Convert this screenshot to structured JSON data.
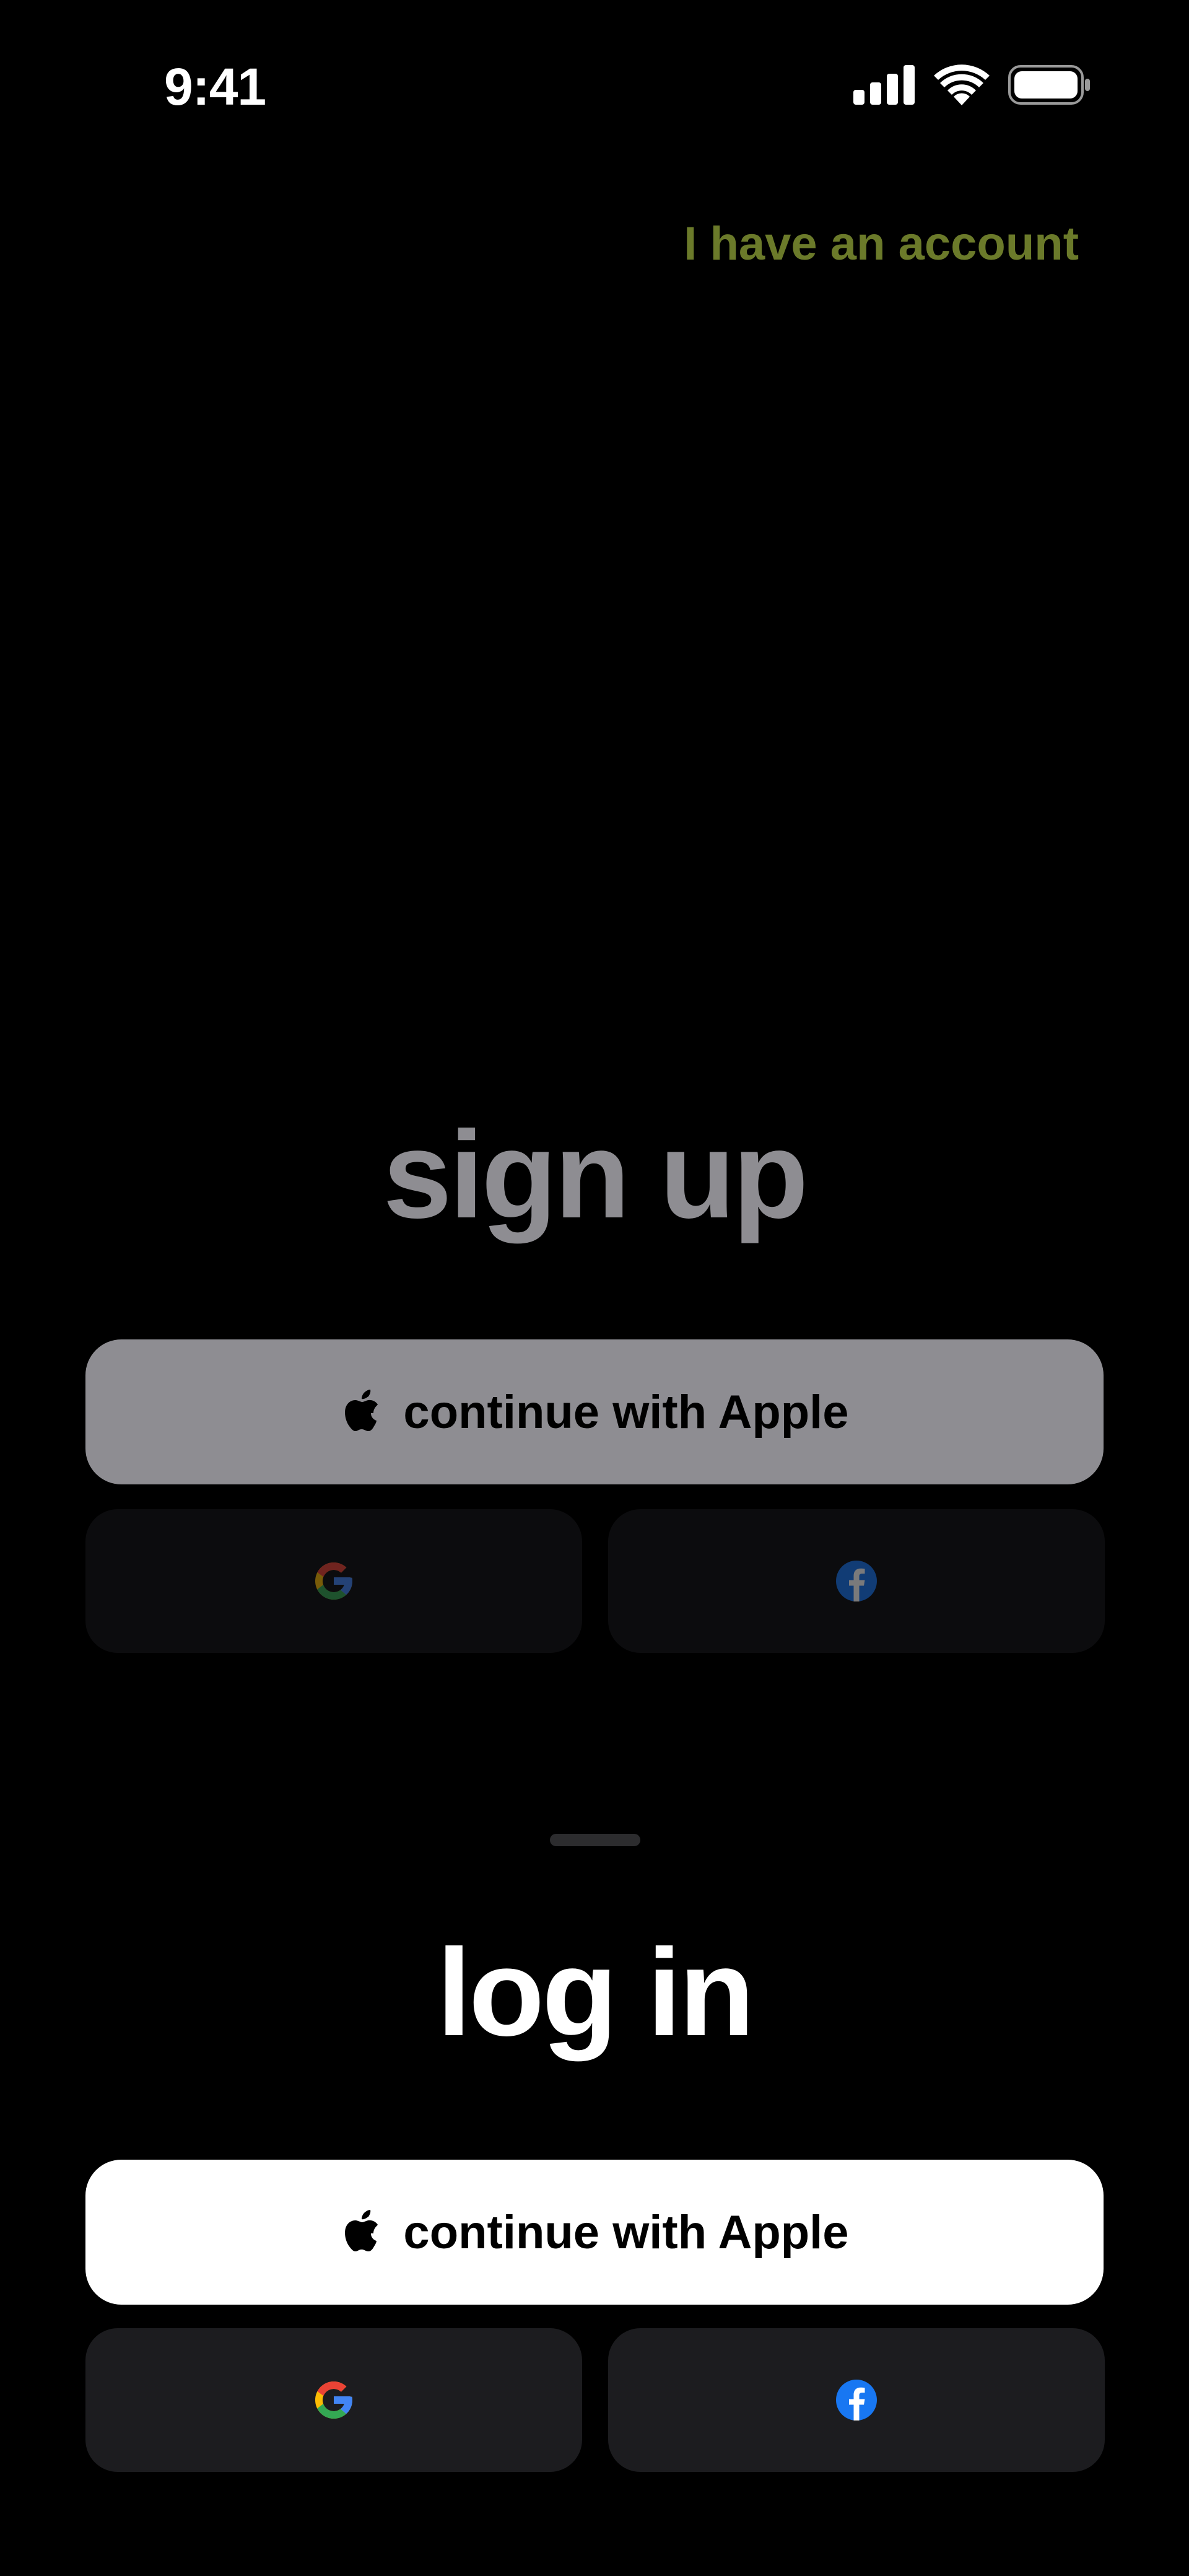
{
  "status_bar": {
    "time": "9:41"
  },
  "header": {
    "account_link_label": "I have an account"
  },
  "signup": {
    "title": "sign up",
    "apple_button_label": "continue with Apple"
  },
  "login": {
    "title": "log in",
    "apple_button_label": "continue with Apple"
  },
  "icons": {
    "signal": "cellular-signal-icon",
    "wifi": "wifi-icon",
    "battery": "battery-icon",
    "apple": "apple-icon",
    "google": "google-icon",
    "facebook": "facebook-icon"
  },
  "colors": {
    "background": "#000000",
    "accent_link": "#6b7a2a",
    "signup_button": "#8e8d92",
    "login_button": "#ffffff",
    "google_blue": "#4285F4",
    "google_red": "#EA4335",
    "google_yellow": "#FBBC05",
    "google_green": "#34A853",
    "facebook_blue": "#1877F2"
  }
}
